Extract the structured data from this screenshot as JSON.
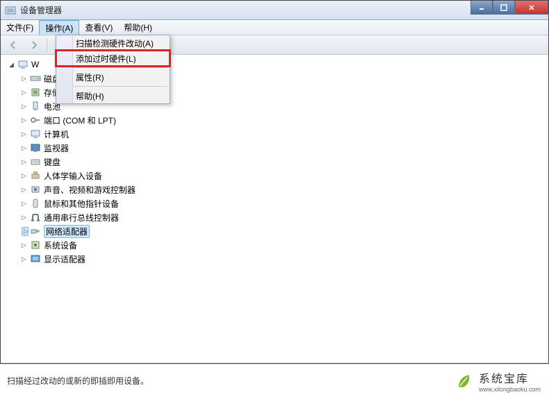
{
  "window": {
    "title": "设备管理器"
  },
  "menu": {
    "file": "文件(F)",
    "action": "操作(A)",
    "view": "查看(V)",
    "help": "帮助(H)"
  },
  "dropdown": {
    "scan": "扫描检测硬件改动(A)",
    "addLegacy": "添加过时硬件(L)",
    "properties": "属性(R)",
    "help": "帮助(H)"
  },
  "tree": {
    "root": "W",
    "items": [
      "磁盘驱动器",
      "存储控制器",
      "电池",
      "端口 (COM 和 LPT)",
      "计算机",
      "监视器",
      "键盘",
      "人体学输入设备",
      "声音、视频和游戏控制器",
      "鼠标和其他指针设备",
      "通用串行总线控制器",
      "网络适配器",
      "系统设备",
      "显示适配器"
    ],
    "selectedIndex": 11
  },
  "statusbar": {
    "text": "扫描经过改动的或新的即插即用设备。"
  },
  "watermark": {
    "name": "系统宝库",
    "url": "www.xilongbaoku.com"
  }
}
